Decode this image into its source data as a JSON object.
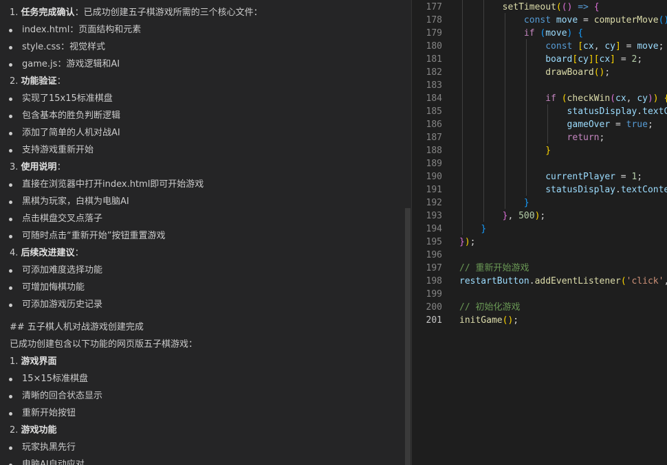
{
  "chat": {
    "s1": {
      "num": "1. ",
      "title": "任务完成确认",
      "text": "：已成功创建五子棋游戏所需的三个核心文件："
    },
    "s1_items": [
      "index.html：页面结构和元素",
      "style.css：视觉样式",
      "game.js：游戏逻辑和AI"
    ],
    "s2": {
      "num": "2. ",
      "title": "功能验证",
      "text": "："
    },
    "s2_items": [
      "实现了15x15标准棋盘",
      "包含基本的胜负判断逻辑",
      "添加了简单的人机对战AI",
      "支持游戏重新开始"
    ],
    "s3": {
      "num": "3. ",
      "title": "使用说明",
      "text": "："
    },
    "s3_items": [
      "直接在浏览器中打开index.html即可开始游戏",
      "黑棋为玩家，白棋为电脑AI",
      "点击棋盘交叉点落子",
      "可随时点击“重新开始”按钮重置游戏"
    ],
    "s4": {
      "num": "4. ",
      "title": "后续改进建议",
      "text": "："
    },
    "s4_items": [
      "可添加难度选择功能",
      "可增加悔棋功能",
      "可添加游戏历史记录"
    ],
    "heading": "## 五子棋人机对战游戏创建完成",
    "intro": "已成功创建包含以下功能的网页版五子棋游戏：",
    "g1": {
      "num": "1. ",
      "title": "游戏界面",
      "text": ""
    },
    "g1_items": [
      "15×15标准棋盘",
      "清晰的回合状态显示",
      "重新开始按钮"
    ],
    "g2": {
      "num": "2. ",
      "title": "游戏功能",
      "text": ""
    },
    "g2_items": [
      "玩家执黑先行",
      "电脑AI自动应对"
    ]
  },
  "editor": {
    "active_line": "201",
    "lines": [
      {
        "n": "177",
        "t": [
          [
            "        ",
            "p"
          ],
          [
            "setTimeout",
            "fn"
          ],
          [
            "(",
            "b1"
          ],
          [
            "(",
            "b2"
          ],
          [
            ")",
            "b2"
          ],
          [
            " => ",
            "kw"
          ],
          [
            "{",
            "b2"
          ]
        ]
      },
      {
        "n": "178",
        "t": [
          [
            "            ",
            "p"
          ],
          [
            "const",
            "kw"
          ],
          [
            " ",
            "p"
          ],
          [
            "move",
            "var"
          ],
          [
            " = ",
            "p"
          ],
          [
            "computerMove",
            "fn"
          ],
          [
            "()",
            "b3"
          ],
          [
            ";",
            "p"
          ]
        ]
      },
      {
        "n": "179",
        "t": [
          [
            "            ",
            "p"
          ],
          [
            "if",
            "ctrl"
          ],
          [
            " ",
            "p"
          ],
          [
            "(",
            "b3"
          ],
          [
            "move",
            "var"
          ],
          [
            ")",
            "b3"
          ],
          [
            " ",
            "p"
          ],
          [
            "{",
            "b3"
          ]
        ]
      },
      {
        "n": "180",
        "t": [
          [
            "                ",
            "p"
          ],
          [
            "const",
            "kw"
          ],
          [
            " ",
            "p"
          ],
          [
            "[",
            "b1"
          ],
          [
            "cx",
            "var"
          ],
          [
            ", ",
            "p"
          ],
          [
            "cy",
            "var"
          ],
          [
            "]",
            "b1"
          ],
          [
            " = ",
            "p"
          ],
          [
            "move",
            "var"
          ],
          [
            ";",
            "p"
          ]
        ]
      },
      {
        "n": "181",
        "t": [
          [
            "                ",
            "p"
          ],
          [
            "board",
            "var"
          ],
          [
            "[",
            "b1"
          ],
          [
            "cy",
            "var"
          ],
          [
            "]",
            "b1"
          ],
          [
            "[",
            "b1"
          ],
          [
            "cx",
            "var"
          ],
          [
            "]",
            "b1"
          ],
          [
            " = ",
            "p"
          ],
          [
            "2",
            "num"
          ],
          [
            ";",
            "p"
          ]
        ]
      },
      {
        "n": "182",
        "t": [
          [
            "                ",
            "p"
          ],
          [
            "drawBoard",
            "fn"
          ],
          [
            "()",
            "b1"
          ],
          [
            ";",
            "p"
          ]
        ]
      },
      {
        "n": "183",
        "t": []
      },
      {
        "n": "184",
        "t": [
          [
            "                ",
            "p"
          ],
          [
            "if",
            "ctrl"
          ],
          [
            " ",
            "p"
          ],
          [
            "(",
            "b1"
          ],
          [
            "checkWin",
            "fn"
          ],
          [
            "(",
            "b2"
          ],
          [
            "cx",
            "var"
          ],
          [
            ", ",
            "p"
          ],
          [
            "cy",
            "var"
          ],
          [
            ")",
            "b2"
          ],
          [
            ")",
            "b1"
          ],
          [
            " ",
            "p"
          ],
          [
            "{",
            "b1"
          ]
        ]
      },
      {
        "n": "185",
        "t": [
          [
            "                    ",
            "p"
          ],
          [
            "statusDisplay",
            "var"
          ],
          [
            ".",
            "p"
          ],
          [
            "textContent",
            "var"
          ]
        ]
      },
      {
        "n": "186",
        "t": [
          [
            "                    ",
            "p"
          ],
          [
            "gameOver",
            "var"
          ],
          [
            " = ",
            "p"
          ],
          [
            "true",
            "kw"
          ],
          [
            ";",
            "p"
          ]
        ]
      },
      {
        "n": "187",
        "t": [
          [
            "                    ",
            "p"
          ],
          [
            "return",
            "ctrl"
          ],
          [
            ";",
            "p"
          ]
        ]
      },
      {
        "n": "188",
        "t": [
          [
            "                ",
            "p"
          ],
          [
            "}",
            "b1"
          ]
        ]
      },
      {
        "n": "189",
        "t": []
      },
      {
        "n": "190",
        "t": [
          [
            "                ",
            "p"
          ],
          [
            "currentPlayer",
            "var"
          ],
          [
            " = ",
            "p"
          ],
          [
            "1",
            "num"
          ],
          [
            ";",
            "p"
          ]
        ]
      },
      {
        "n": "191",
        "t": [
          [
            "                ",
            "p"
          ],
          [
            "statusDisplay",
            "var"
          ],
          [
            ".",
            "p"
          ],
          [
            "textContent",
            "var"
          ]
        ]
      },
      {
        "n": "192",
        "t": [
          [
            "            ",
            "p"
          ],
          [
            "}",
            "b3"
          ]
        ]
      },
      {
        "n": "193",
        "t": [
          [
            "        ",
            "p"
          ],
          [
            "}",
            "b2"
          ],
          [
            ", ",
            "p"
          ],
          [
            "500",
            "num"
          ],
          [
            ")",
            "b1"
          ],
          [
            ";",
            "p"
          ]
        ]
      },
      {
        "n": "194",
        "t": [
          [
            "    ",
            "p"
          ],
          [
            "}",
            "b3"
          ]
        ]
      },
      {
        "n": "195",
        "t": [
          [
            "}",
            "b2"
          ],
          [
            ")",
            "b1"
          ],
          [
            ";",
            "p"
          ]
        ]
      },
      {
        "n": "196",
        "t": []
      },
      {
        "n": "197",
        "t": [
          [
            "// 重新开始游戏",
            "com"
          ]
        ]
      },
      {
        "n": "198",
        "t": [
          [
            "restartButton",
            "var"
          ],
          [
            ".",
            "p"
          ],
          [
            "addEventListener",
            "fn"
          ],
          [
            "(",
            "b1"
          ],
          [
            "'click'",
            "str"
          ],
          [
            ",",
            "p"
          ]
        ]
      },
      {
        "n": "199",
        "t": []
      },
      {
        "n": "200",
        "t": [
          [
            "// 初始化游戏",
            "com"
          ]
        ]
      },
      {
        "n": "201",
        "t": [
          [
            "initGame",
            "fn"
          ],
          [
            "()",
            "b1"
          ],
          [
            ";",
            "p"
          ]
        ]
      }
    ]
  }
}
